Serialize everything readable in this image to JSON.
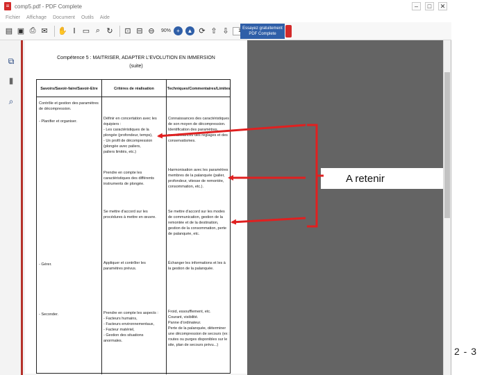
{
  "window": {
    "title": "comp5.pdf - PDF Complete",
    "controls": [
      "–",
      "□",
      "✕"
    ]
  },
  "menu": [
    "Fichier",
    "Affichage",
    "Document",
    "Outils",
    "Aide"
  ],
  "toolbar": {
    "zoom": "90%",
    "page_current": "1",
    "page_total": "/1",
    "promo_text": "Essayez gratuitement PDF Complete"
  },
  "document": {
    "title": "Compétence 5 : MAITRISER, ADAPTER L'EVOLUTION EN IMMERSION",
    "subtitle": "(suite)",
    "columns": [
      "Savoirs/Savoir-faire/Savoir-Etre",
      "Critères de réalisation",
      "Techniques/Commentaires/Limites"
    ],
    "col1": [
      "Contrôle et gestion des paramètres\nde décompression.",
      "  -   Planifier et organiser.",
      "  -   Gérer.",
      "  -   Seconder."
    ],
    "col2": [
      "Définir en concertation avec les\néquipiers :\n  -   Les caractéristiques de la\n      plongée (profondeur, temps),\n  -   Un profil de décompression\n      (plongée avec paliers,\n      paliers limités, etc.)",
      "Prendre en compte les\ncaractéristiques des différents\ninstruments de plongée.",
      "Se mettre d'accord sur les\nprocédures à mettre en œuvre.",
      "Appliquer et contrôler les\nparamètres prévus.",
      "Prendre en compte les aspects :\n  -   Facteurs humains,\n  -   Facteurs environnementaux,\n  -   Facteur matériel,\n  -   Gestion des situations\n      anormales."
    ],
    "col3": [
      "Connaissances des caractéristiques\nde son moyen de décompression.\nIdentification des paramètres,\nconnaissances des réglages et des\nconservatismes.",
      "Harmonisation avec les paramètres\nmembres de la palanquée (palier,\nprofondeur, vitesse de remontée,\nconsommation, etc.).",
      "Se mettre d'accord sur les modes\nde communication, gestion de la\nremontée et de la destination,\ngestion de la consommation, perte\nde palanquée, etc.",
      "Échanger les informations et les à\nla gestion de la palanquée.",
      "Froid, essoufflement, etc.\nCourant, visibilité.\nPanne d'ordinateur.\nPerte de la palanquée, déterminer\nune décompression de secours (ex :\nroutes ou purges disponibles sur le\nsite, plan de secours prévu...)"
    ]
  },
  "annotation": {
    "label": "A retenir",
    "arrow_color": "#e02020"
  },
  "slide_number": "2 - 3"
}
